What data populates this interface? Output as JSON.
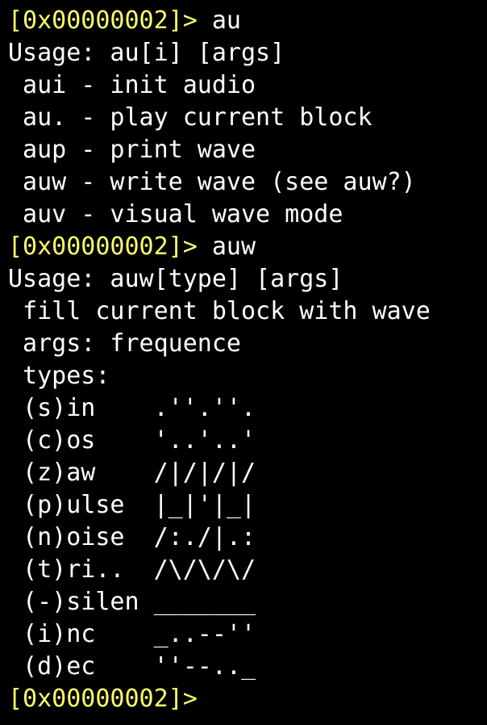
{
  "colors": {
    "background": "#000000",
    "prompt": "#ffff66",
    "text": "#ffffff"
  },
  "terminal": {
    "lines": [
      {
        "prompt": "[0x00000002]>",
        "command": " au"
      },
      {
        "text": "Usage: au[i] [args]"
      },
      {
        "text": " aui - init audio"
      },
      {
        "text": " au. - play current block"
      },
      {
        "text": " aup - print wave"
      },
      {
        "text": " auw - write wave (see auw?)"
      },
      {
        "text": " auv - visual wave mode"
      },
      {
        "prompt": "[0x00000002]>",
        "command": " auw"
      },
      {
        "text": "Usage: auw[type] [args]"
      },
      {
        "text": " fill current block with wave"
      },
      {
        "text": " args: frequence"
      },
      {
        "text": " types:"
      },
      {
        "text": " (s)in    .''.''."
      },
      {
        "text": " (c)os    '..'..'"
      },
      {
        "text": " (z)aw    /|/|/|/"
      },
      {
        "text": " (p)ulse  |_|'|_|"
      },
      {
        "text": " (n)oise  /:./|.:"
      },
      {
        "text": " (t)ri..  /\\/\\/\\/"
      },
      {
        "text": " (-)silen _______"
      },
      {
        "text": " (i)nc    _..--''"
      },
      {
        "text": " (d)ec    ''--.._"
      },
      {
        "prompt": "[0x00000002]>",
        "command": ""
      }
    ]
  }
}
